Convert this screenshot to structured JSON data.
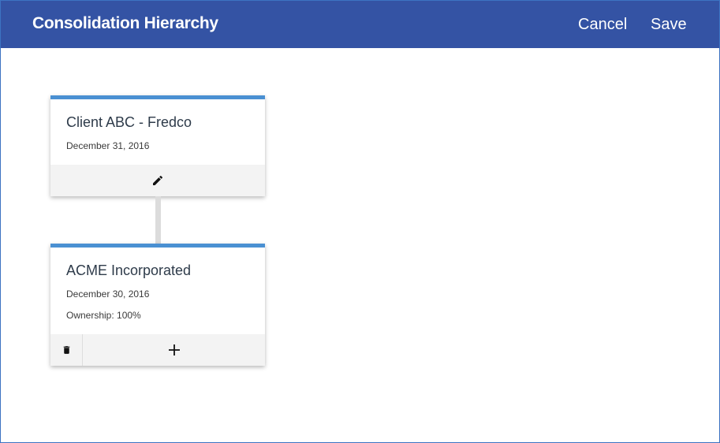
{
  "header": {
    "title": "Consolidation Hierarchy",
    "cancel_label": "Cancel",
    "save_label": "Save"
  },
  "colors": {
    "header_bg": "#3453a4",
    "card_accent": "#4a90d2",
    "footer_bg": "#f3f3f3"
  },
  "nodes": [
    {
      "name": "Client ABC - Fredco",
      "date": "December 31, 2016",
      "actions": [
        "pencil-icon"
      ]
    },
    {
      "name": "ACME Incorporated",
      "date": "December 30, 2016",
      "ownership": "Ownership: 100%",
      "actions": [
        "trash-icon",
        "plus-icon"
      ]
    }
  ]
}
